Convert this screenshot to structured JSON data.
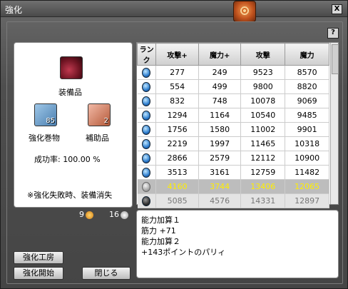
{
  "window": {
    "title": "強化",
    "close_label": "X",
    "help_label": "?"
  },
  "left": {
    "equip_label": "装備品",
    "scroll_label": "強化巻物",
    "scroll_count": "85",
    "support_label": "補助品",
    "support_count": "2",
    "success_rate": "成功率: 100.00 %",
    "warning": "※強化失敗時、装備消失"
  },
  "table": {
    "headers": [
      "ランク",
      "攻撃+",
      "魔力+",
      "攻撃",
      "魔力"
    ],
    "rows": [
      [
        "277",
        "249",
        "9523",
        "8570"
      ],
      [
        "554",
        "499",
        "9800",
        "8820"
      ],
      [
        "832",
        "748",
        "10078",
        "9069"
      ],
      [
        "1294",
        "1164",
        "10540",
        "9485"
      ],
      [
        "1756",
        "1580",
        "11002",
        "9901"
      ],
      [
        "2219",
        "1997",
        "11465",
        "10318"
      ],
      [
        "2866",
        "2579",
        "12112",
        "10900"
      ],
      [
        "3513",
        "3161",
        "12759",
        "11482"
      ],
      [
        "4160",
        "3744",
        "13406",
        "12065"
      ],
      [
        "5085",
        "4576",
        "14331",
        "12897"
      ]
    ]
  },
  "counters": {
    "gold": "9",
    "silver": "16"
  },
  "description": [
    "能力加算１",
    "筋力 +71",
    "能力加算２",
    "+143ポイントのパリィ"
  ],
  "buttons": {
    "workshop": "強化工房",
    "start": "強化開始",
    "close": "閉じる"
  }
}
